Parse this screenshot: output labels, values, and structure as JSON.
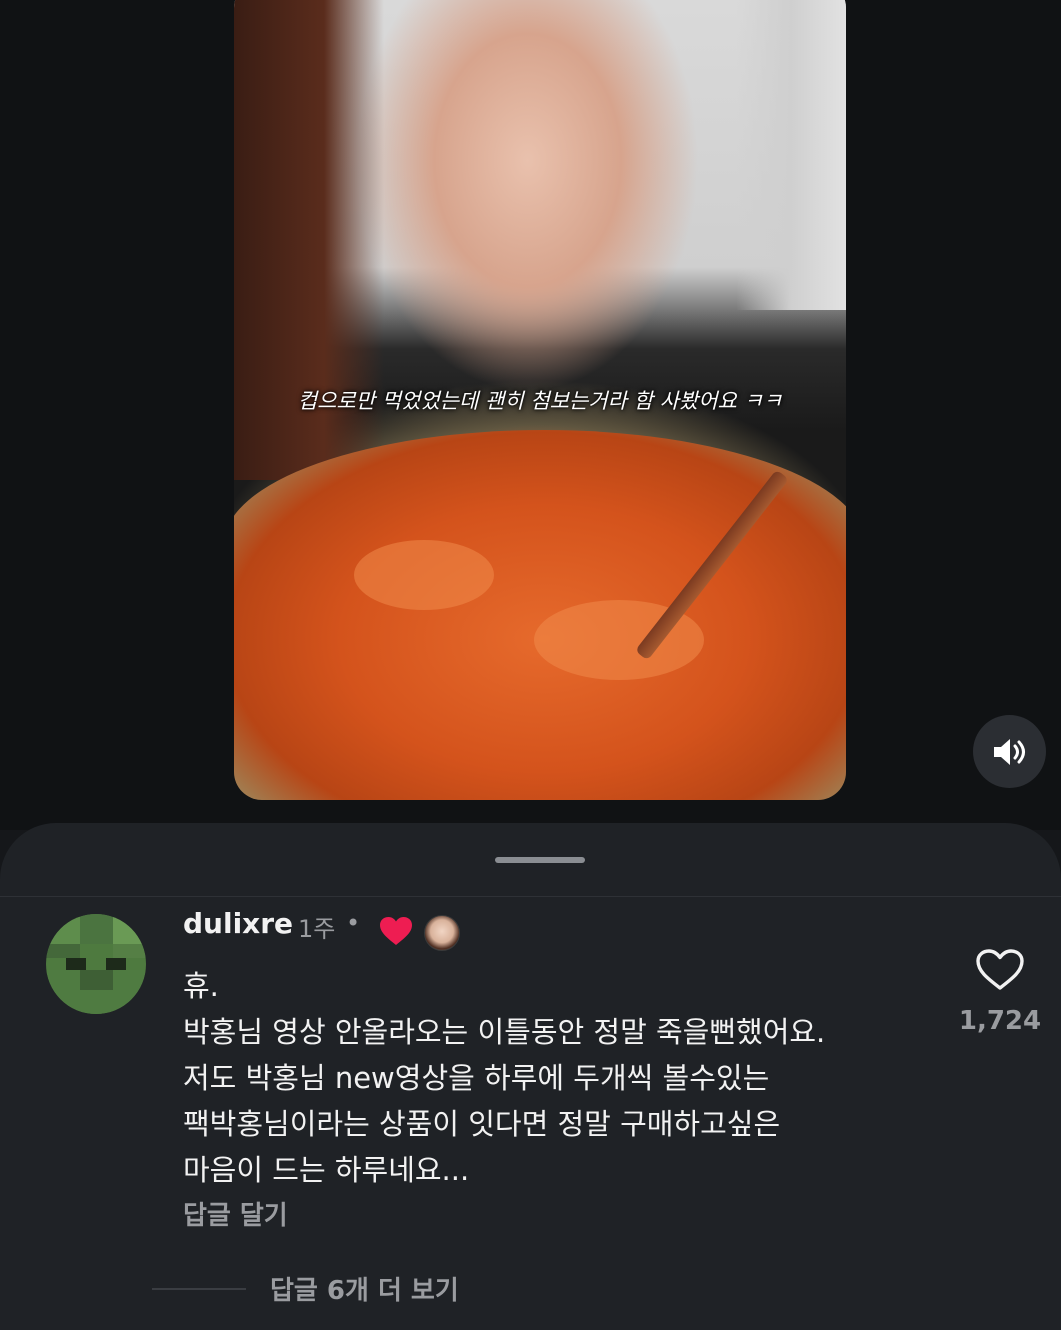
{
  "video": {
    "subtitle": "컵으로만 먹었었는데 괜히 첨보는거라 함 사봤어요 ㅋㅋ",
    "sound_icon": "speaker-volume-icon"
  },
  "comment": {
    "username": "dulixre",
    "time": "1주",
    "separator": "•",
    "creator_liked_icon": "heart-filled-icon",
    "text": "휴.\n박홍님 영상 안올라오는 이틀동안 정말 죽을뻔했어요.\n저도 박홍님 new영상을 하루에 두개씩 볼수있는\n팩박홍님이라는 상품이 잇다면 정말 구매하고싶은\n마음이 드는 하루네요...",
    "reply_label": "답글 달기",
    "like_icon": "heart-outline-icon",
    "like_count": "1,724",
    "view_more_replies": "답글 6개 더 보기"
  },
  "colors": {
    "background": "#15171a",
    "sheet": "#1f2226",
    "like_red": "#ee1d52",
    "muted_text": "#9a9ca0"
  }
}
